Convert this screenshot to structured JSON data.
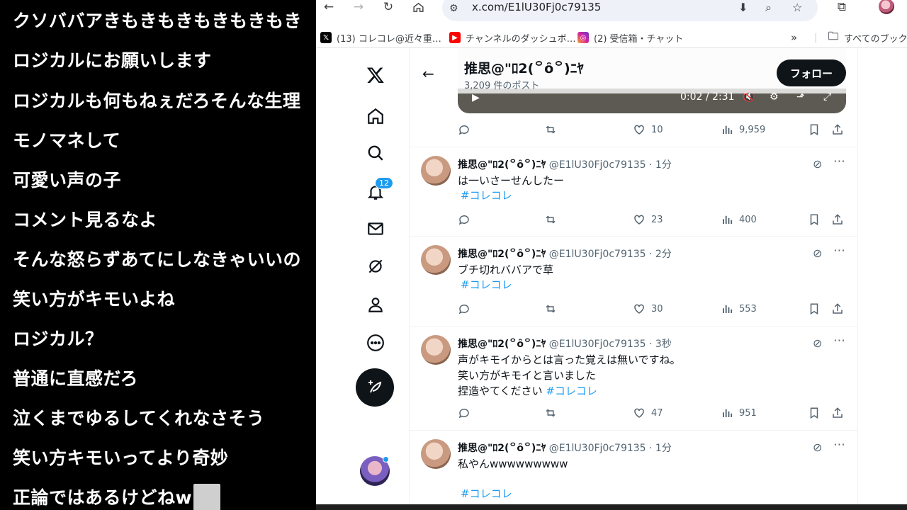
{
  "comments": [
    "クソババアきもきもきもきもきもき",
    "ロジカルにお願いします",
    "ロジカルも何もねぇだろそんな生理",
    "モノマネして",
    "可愛い声の子",
    "コメント見るなよ",
    "そんな怒らずあてにしなきゃいいの",
    "笑い方がキモいよね",
    "ロジカル？",
    "普通に直感だろ",
    "泣くまでゆるしてくれなさそう",
    "笑い方キモいってより奇妙",
    "正論ではあるけどねw"
  ],
  "browser": {
    "url": "x.com/E1lU30Fj0c79135",
    "bookmarks": [
      {
        "label": "(13) コレコレ@近々重…",
        "icon": "x-logo-favicon",
        "color": "#000000"
      },
      {
        "label": "チャンネルのダッシュボ…",
        "icon": "youtube-favicon",
        "color": "#ff0000"
      },
      {
        "label": "(2) 受信箱・チャット",
        "icon": "instagram-favicon",
        "color": "#d6249f"
      },
      {
        "label": "すべてのブックマ",
        "icon": "folder-icon",
        "color": "#5f6368"
      }
    ]
  },
  "xpage": {
    "profile_name": "推思@\"ﾛ2(꒪ȏ꒪)ﾆﾔ",
    "post_count": "3,209 件のポスト",
    "follow_label": "フォロー",
    "notif_count": "12",
    "video": {
      "time": "0:02 / 2:31"
    },
    "top_actions": {
      "likes": "10",
      "views": "9,959"
    },
    "tweets": [
      {
        "name": "推思@\"ﾛ2(꒪ȏ꒪)ﾆﾔ",
        "meta": "@E1lU30Fj0c79135 · 1分",
        "lines": [
          "は一いさーせんしたー"
        ],
        "hashtag": "#コレコレ",
        "likes": "23",
        "views": "400"
      },
      {
        "name": "推思@\"ﾛ2(꒪ȏ꒪)ﾆﾔ",
        "meta": "@E1lU30Fj0c79135 · 2分",
        "lines": [
          "ブチ切れババアで草"
        ],
        "hashtag": "#コレコレ",
        "likes": "30",
        "views": "553"
      },
      {
        "name": "推思@\"ﾛ2(꒪ȏ꒪)ﾆﾔ",
        "meta": "@E1lU30Fj0c79135 · 3秒",
        "lines": [
          "声がキモイからとは言った覚えは無いですね。",
          "笑い方がキモイと言いました",
          "捏造やてください"
        ],
        "hashtag": "#コレコレ",
        "likes": "47",
        "views": "951"
      },
      {
        "name": "推思@\"ﾛ2(꒪ȏ꒪)ﾆﾔ",
        "meta": "@E1lU30Fj0c79135 · 1分",
        "lines": [
          "私やんwwwwwwwww"
        ],
        "hashtag": "#コレコレ"
      }
    ]
  }
}
